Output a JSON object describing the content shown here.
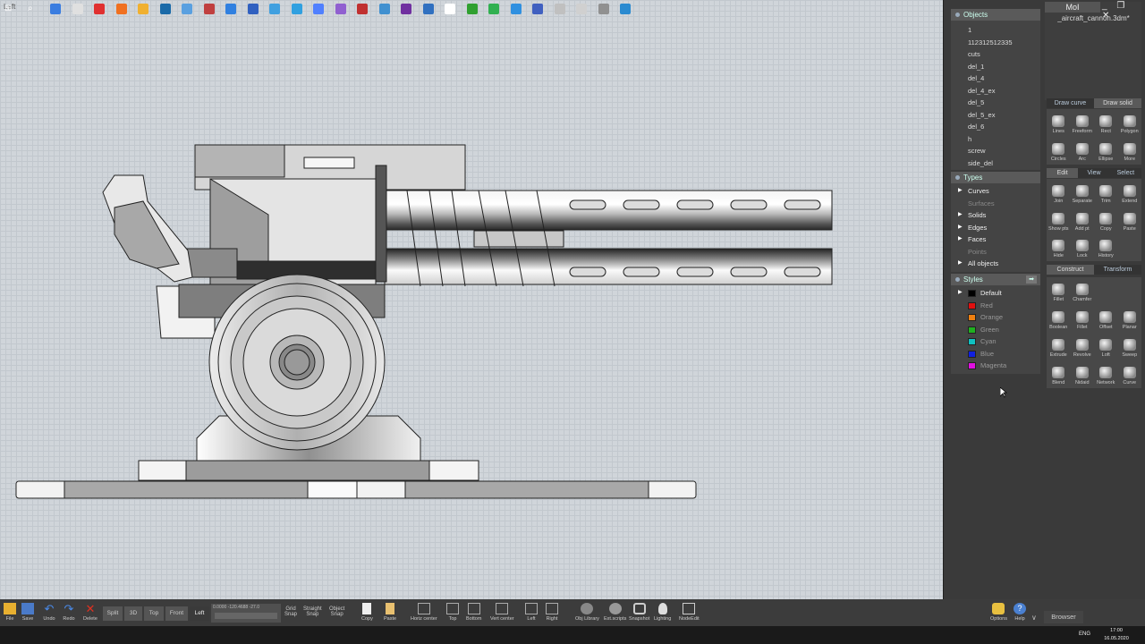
{
  "viewport": {
    "label": "Left"
  },
  "app": {
    "name": "MoI",
    "file": "_aircraft_cannon.3dm*",
    "window_controls": "_ ❐ ✕"
  },
  "objects": {
    "title": "Objects",
    "items": [
      "1",
      "112312512335",
      "cuts",
      "del_1",
      "del_4",
      "del_4_ex",
      "del_5",
      "del_5_ex",
      "del_6",
      "h",
      "screw",
      "side_del"
    ]
  },
  "types": {
    "title": "Types",
    "items": [
      {
        "label": "Curves",
        "enabled": true
      },
      {
        "label": "Surfaces",
        "enabled": false
      },
      {
        "label": "Solids",
        "enabled": true
      },
      {
        "label": "Edges",
        "enabled": true
      },
      {
        "label": "Faces",
        "enabled": true
      },
      {
        "label": "Points",
        "enabled": false
      },
      {
        "label": "All objects",
        "enabled": true
      }
    ]
  },
  "styles": {
    "title": "Styles",
    "items": [
      {
        "label": "Default",
        "color": "#000000"
      },
      {
        "label": "Red",
        "color": "#e01010"
      },
      {
        "label": "Orange",
        "color": "#f08010"
      },
      {
        "label": "Green",
        "color": "#20b020"
      },
      {
        "label": "Cyan",
        "color": "#10c0c0"
      },
      {
        "label": "Blue",
        "color": "#1020e0"
      },
      {
        "label": "Magenta",
        "color": "#e010e0"
      }
    ]
  },
  "draw_tabs": [
    "Draw curve",
    "Draw solid"
  ],
  "draw_tools": [
    {
      "label": "Lines",
      "icon": "line-icon"
    },
    {
      "label": "Freeform",
      "icon": "freeform-icon"
    },
    {
      "label": "Rect",
      "icon": "rect-icon"
    },
    {
      "label": "Polygon",
      "icon": "polygon-icon"
    },
    {
      "label": "Circles",
      "icon": "circle-icon"
    },
    {
      "label": "Arc",
      "icon": "arc-icon"
    },
    {
      "label": "Ellipse",
      "icon": "ellipse-icon"
    },
    {
      "label": "More",
      "icon": "more-icon"
    }
  ],
  "edit_tabs": [
    "Edit",
    "View",
    "Select"
  ],
  "edit_tools": [
    {
      "label": "Join",
      "icon": "join-icon"
    },
    {
      "label": "Separate",
      "icon": "separate-icon"
    },
    {
      "label": "Trim",
      "icon": "trim-icon"
    },
    {
      "label": "Extend",
      "icon": "extend-icon"
    },
    {
      "label": "Show pts",
      "icon": "show-points-icon"
    },
    {
      "label": "Add pt",
      "icon": "add-point-icon"
    },
    {
      "label": "Copy",
      "icon": "copy-icon"
    },
    {
      "label": "Paste",
      "icon": "paste-icon"
    },
    {
      "label": "Hide",
      "icon": "hide-icon"
    },
    {
      "label": "Lock",
      "icon": "lock-icon"
    },
    {
      "label": "History",
      "icon": "history-icon"
    }
  ],
  "construct_tabs": [
    "Construct",
    "Transform"
  ],
  "construct_tools": [
    {
      "label": "Fillet",
      "icon": "fillet-icon"
    },
    {
      "label": "Chamfer",
      "icon": "chamfer-icon"
    },
    {
      "label": "",
      "icon": ""
    },
    {
      "label": "",
      "icon": ""
    },
    {
      "label": "Boolean",
      "icon": "boolean-icon"
    },
    {
      "label": "Fillet",
      "icon": "fillet2-icon"
    },
    {
      "label": "Offset",
      "icon": "offset-icon"
    },
    {
      "label": "Planar",
      "icon": "planar-icon"
    },
    {
      "label": "Extrude",
      "icon": "extrude-icon"
    },
    {
      "label": "Revolve",
      "icon": "revolve-icon"
    },
    {
      "label": "Loft",
      "icon": "loft-icon"
    },
    {
      "label": "Sweep",
      "icon": "sweep-icon"
    },
    {
      "label": "Blend",
      "icon": "blend-icon"
    },
    {
      "label": "Nidaid",
      "icon": "network-solid-icon"
    },
    {
      "label": "Network",
      "icon": "network-icon"
    },
    {
      "label": "Curve",
      "icon": "curve-icon"
    }
  ],
  "bottom": {
    "file": "File",
    "save": "Save",
    "undo": "Undo",
    "redo": "Redo",
    "delete": "Delete",
    "views": [
      "Split",
      "3D",
      "Top",
      "Front",
      "Left"
    ],
    "coord": "0.0000 -120.4688 -27.0",
    "grid_snap": "Grid\nSnap",
    "straight_snap": "Straight\nSnap",
    "object_snap": "Object\nSnap",
    "copy": "Copy",
    "paste": "Paste",
    "align": [
      "Horiz center",
      "Top",
      "Bottom",
      "Vert center",
      "Left",
      "Right"
    ],
    "extras": [
      "Obj Library",
      "Ext.scripts",
      "Snapshot",
      "Lighting",
      "NodeEdit"
    ],
    "options": "Options",
    "help": "Help",
    "browser": "Browser"
  },
  "taskbar": {
    "lang": "ENG",
    "time": "17:00",
    "date": "16.05.2020"
  }
}
